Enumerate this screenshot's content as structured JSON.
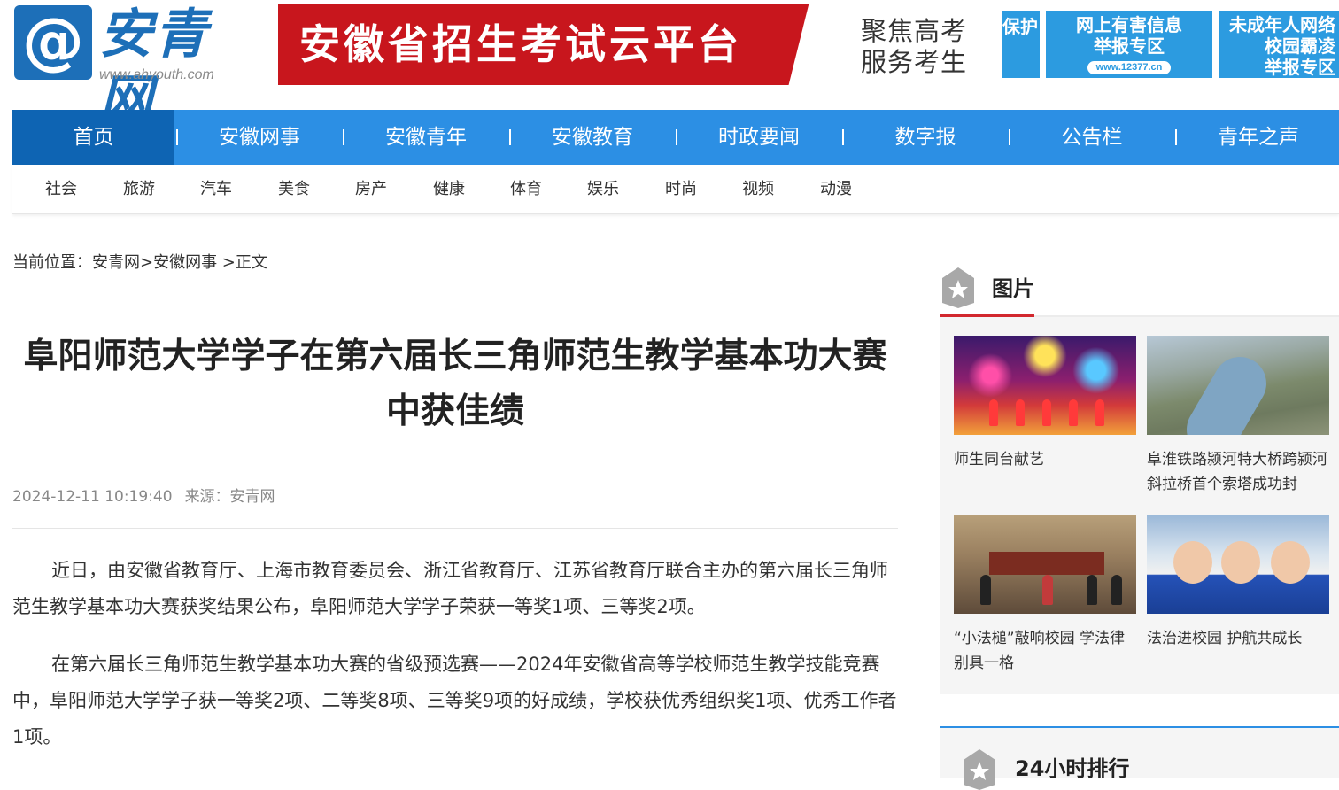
{
  "header": {
    "logo_symbol": "@",
    "logo_name": "安青网",
    "logo_url": "www.ahyouth.com",
    "banner_main": "安徽省招生考试云平台",
    "banner_slogan": [
      "聚焦高考",
      "服务考生"
    ],
    "tiles": {
      "tile1": "保护",
      "tile2_line1": "网上有害信息",
      "tile2_line2": "举报专区",
      "tile2_url": "www.12377.cn",
      "tile3_line1": "未成年人网络",
      "tile3_line2": "校园霸凌",
      "tile3_line3": "举报专区"
    },
    "colors": {
      "brand_blue": "#2c8fe4",
      "banner_red": "#c8161d",
      "accent_red": "#d2282e"
    }
  },
  "nav": {
    "main": [
      "首页",
      "安徽网事",
      "安徽青年",
      "安徽教育",
      "时政要闻",
      "数字报",
      "公告栏",
      "青年之声"
    ],
    "sub": [
      "社会",
      "旅游",
      "汽车",
      "美食",
      "房产",
      "健康",
      "体育",
      "娱乐",
      "时尚",
      "视频",
      "动漫"
    ]
  },
  "breadcrumb": {
    "prefix": "当前位置：",
    "path": "安青网>安徽网事 >正文"
  },
  "article": {
    "title_line1": "阜阳师范大学学子在第六届长三角师范生教学基本功大赛",
    "title_line2": "中获佳绩",
    "date": "2024-12-11 10:19:40",
    "source": "来源：安青网",
    "paragraphs": [
      "近日，由安徽省教育厅、上海市教育委员会、浙江省教育厅、江苏省教育厅联合主办的第六届长三角师范生教学基本功大赛获奖结果公布，阜阳师范大学学子荣获一等奖1项、三等奖2项。",
      "在第六届长三角师范生教学基本功大赛的省级预选赛——2024年安徽省高等学校师范生教学技能竞赛中，阜阳师范大学学子获一等奖2项、二等奖8项、三等奖9项的好成绩，学校获优秀组织奖1项、优秀工作者1项。"
    ]
  },
  "sidebar": {
    "pictures_title": "图片",
    "pictures": [
      {
        "caption": "师生同台献艺"
      },
      {
        "caption": "阜淮铁路颍河特大桥跨颍河斜拉桥首个索塔成功封"
      },
      {
        "caption": "“小法槌”敲响校园 学法律别具一格"
      },
      {
        "caption": "法治进校园 护航共成长"
      }
    ],
    "ranking_title": "24小时排行"
  }
}
